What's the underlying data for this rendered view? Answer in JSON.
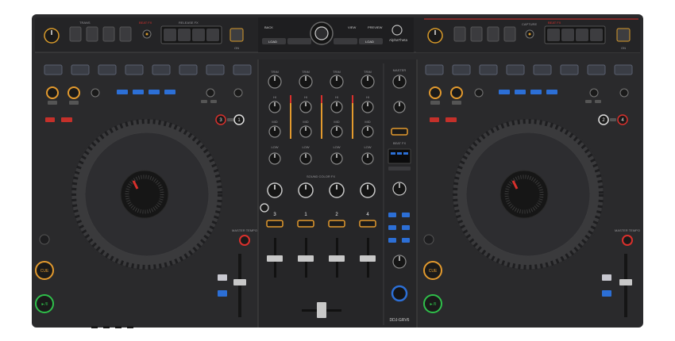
{
  "colors": {
    "body": "#2a2a2c",
    "panel": "#333336",
    "dark": "#1c1c1e",
    "accent_red": "#d9302c",
    "accent_orange": "#e39a2e",
    "accent_blue": "#2c6fd6",
    "label_grey": "#9a9a9e"
  },
  "top_left": {
    "label_trans": "TRANS",
    "label_beat_fx": "BEAT FX",
    "label_on": "ON",
    "label_release_fx": "RELEASE FX"
  },
  "top_right": {
    "label_capture": "CAPTURE",
    "label_beat_fx": "BEAT FX",
    "label_on": "ON"
  },
  "browser": {
    "shift_back": "BACK",
    "load_left": "LOAD",
    "load_right": "LOAD",
    "view": "VIEW",
    "preview": "PREVIEW",
    "brand": "AlphaTheta"
  },
  "left_deck": {
    "cue": "CUE",
    "play": "►/II",
    "master_tempo": "MASTER TEMPO",
    "deck_numbers": [
      "3",
      "1"
    ]
  },
  "right_deck": {
    "cue": "CUE",
    "play": "►/II",
    "master_tempo": "MASTER TEMPO",
    "deck_numbers": [
      "2",
      "4"
    ]
  },
  "mixer": {
    "knob_rows": [
      "TRIM",
      "HI",
      "MID",
      "LOW"
    ],
    "sound_color_fx": "SOUND COLOR FX",
    "channel_labels": [
      "3",
      "1",
      "2",
      "4"
    ],
    "master_label": "MASTER",
    "beat_fx_label": "BEAT FX",
    "model": "DDJ-GRV6"
  }
}
